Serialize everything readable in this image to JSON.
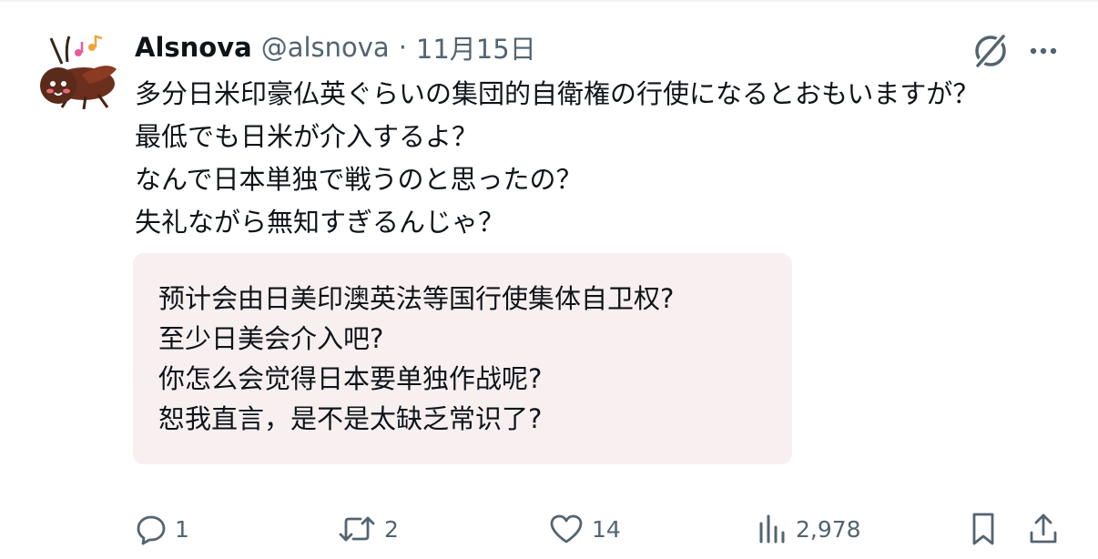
{
  "tweet": {
    "author": {
      "display_name": "Alsnova",
      "handle": "@alsnova",
      "avatar_icon": "cricket-avatar-icon"
    },
    "separator": "·",
    "date": "11月15日",
    "text_lines": [
      "多分日米印豪仏英ぐらいの集団的自衛権の行使になるとおもいますが？",
      "最低でも日米が介入するよ？",
      "なんで日本単独で戦うのと思ったの？",
      "失礼ながら無知すぎるんじゃ？"
    ],
    "translation_lines": [
      "预计会由日美印澳英法等国行使集体自卫权?",
      "至少日美会介入吧?",
      "你怎么会觉得日本要单独作战呢?",
      "恕我直言，是不是太缺乏常识了?"
    ]
  },
  "actions": {
    "reply_count": "1",
    "repost_count": "2",
    "like_count": "14",
    "view_count": "2,978"
  },
  "icons": {
    "grok": "grok-icon",
    "more": "more-icon",
    "reply": "reply-icon",
    "repost": "repost-icon",
    "like": "heart-icon",
    "views": "views-icon",
    "bookmark": "bookmark-icon",
    "share": "share-icon"
  },
  "colors": {
    "text_primary": "#0f1419",
    "text_secondary": "#536471",
    "translation_bg": "#f8f0f0"
  }
}
